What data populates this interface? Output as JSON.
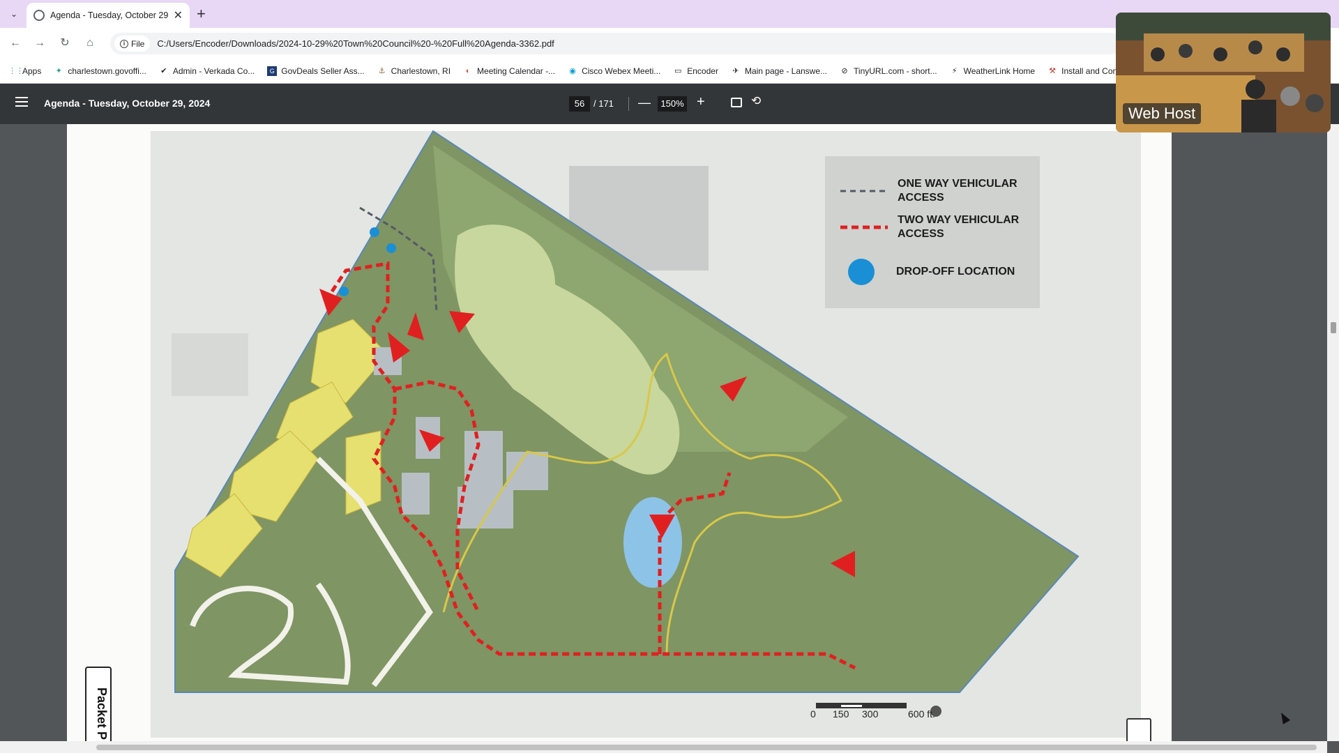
{
  "browser": {
    "tab_title": "Agenda - Tuesday, October 29",
    "new_tab_symbol": "+",
    "site_chip": "File",
    "url": "C:/Users/Encoder/Downloads/2024-10-29%20Town%20Council%20-%20Full%20Agenda-3362.pdf",
    "bookmarks": [
      {
        "label": "Apps",
        "icon": "apps-grid-icon"
      },
      {
        "label": "charlestown.govoffi...",
        "icon": "govoffice-icon"
      },
      {
        "label": "Admin - Verkada Co...",
        "icon": "verkada-icon"
      },
      {
        "label": "GovDeals Seller Ass...",
        "icon": "govdeals-icon"
      },
      {
        "label": "Charlestown, RI",
        "icon": "town-icon"
      },
      {
        "label": "Meeting Calendar -...",
        "icon": "calendar-icon"
      },
      {
        "label": "Cisco Webex Meeti...",
        "icon": "webex-icon"
      },
      {
        "label": "Encoder",
        "icon": "folder-icon"
      },
      {
        "label": "Main page - Lanswe...",
        "icon": "lansweeper-icon"
      },
      {
        "label": "TinyURL.com - short...",
        "icon": "tinyurl-icon"
      },
      {
        "label": "WeatherLink Home",
        "icon": "weatherlink-icon"
      },
      {
        "label": "Install and Con",
        "icon": "install-icon"
      }
    ]
  },
  "pdf": {
    "title": "Agenda - Tuesday, October 29, 2024",
    "current_page": "56",
    "total_pages": "/ 171",
    "zoom": "150%"
  },
  "map": {
    "legend": {
      "one_way_line1": "ONE WAY VEHICULAR",
      "one_way_line2": "ACCESS",
      "two_way_line1": "TWO WAY VEHICULAR",
      "two_way_line2": "ACCESS",
      "drop_off": "DROP-OFF LOCATION"
    },
    "scale": {
      "s0": "0",
      "s1": "150",
      "s2": "300",
      "s3": "600 ft."
    },
    "packet_tab": "Packet P",
    "colors": {
      "two_way": "#e02020",
      "drop_off": "#1a8fd6",
      "one_way": "#555a66",
      "fields": "#e6e070"
    }
  },
  "video_overlay": {
    "label": "Web Host"
  }
}
